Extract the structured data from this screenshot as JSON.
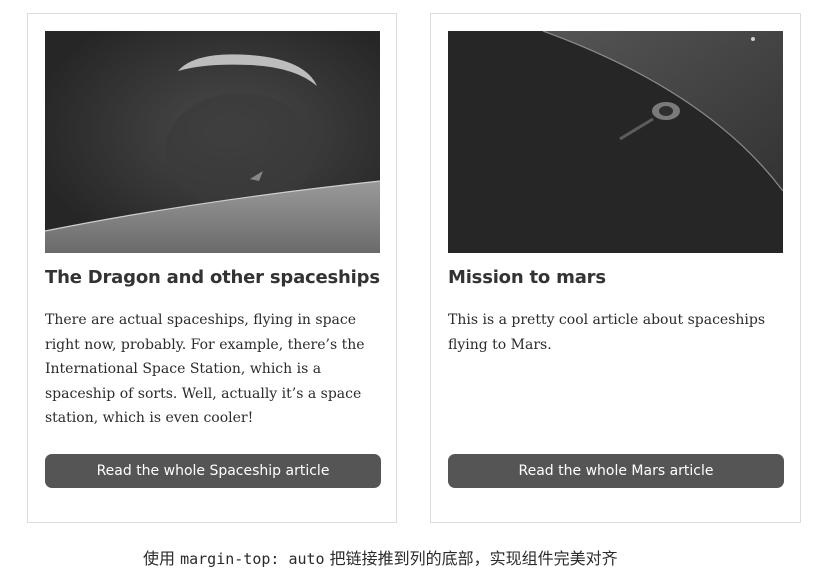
{
  "cards": [
    {
      "title": "The Dragon and other spaceships",
      "text": "There are actual spaceships, flying in space right now, probably. For example, there’s the International Space Station, which is a spaceship of sorts. Well, actually it’s a space station, which is even cooler!",
      "button": "Read the whole Spaceship article"
    },
    {
      "title": "Mission to mars",
      "text": "This is a pretty cool article about spaceships flying to Mars.",
      "button": "Read the whole Mars article"
    }
  ],
  "caption": {
    "before": "使用 ",
    "code": "margin-top: auto",
    "after": " 把链接推到列的底部，实现组件完美对齐"
  },
  "colors": {
    "button_bg": "#555555",
    "image_bg": "#2a2a2a",
    "text": "#2b2b2b",
    "border": "#dcdcdc"
  }
}
